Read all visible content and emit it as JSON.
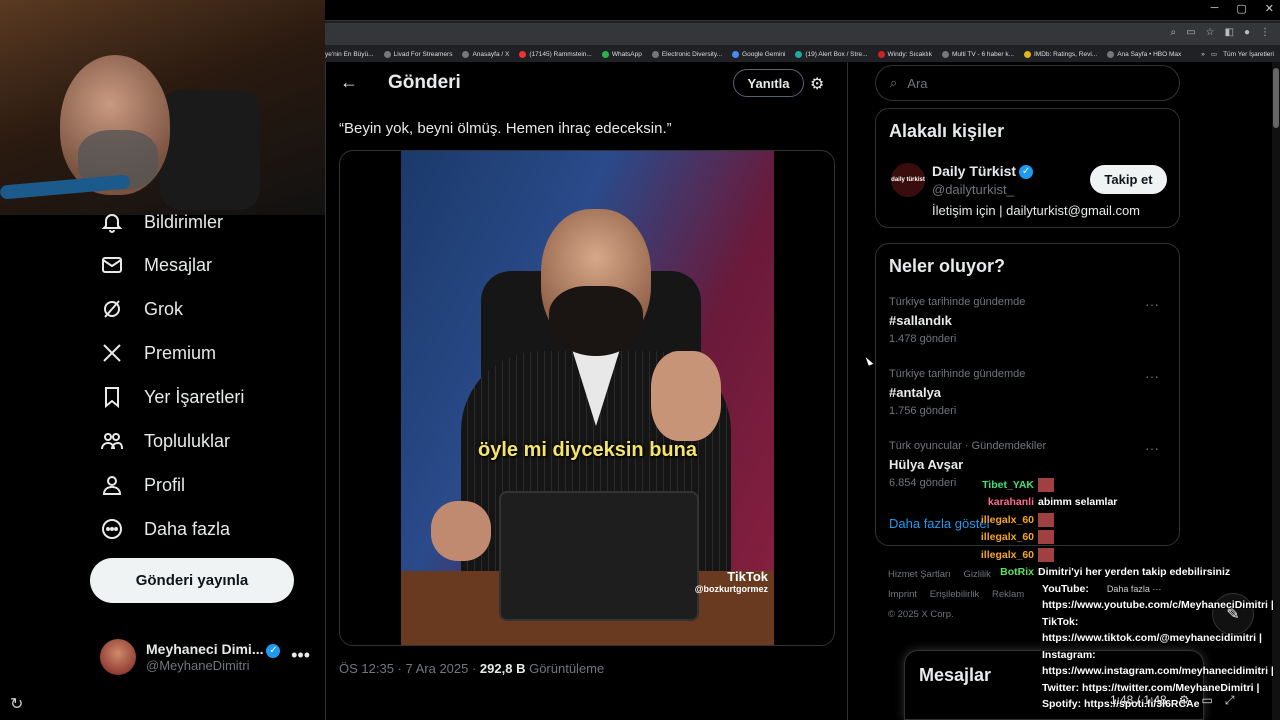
{
  "window": {
    "minimize": "─",
    "maximize": "▢",
    "close": "✕"
  },
  "bookmarks": [
    {
      "label": "ye'nin En Büyü..."
    },
    {
      "label": "Livad For Streamers"
    },
    {
      "label": "Anasayfa / X"
    },
    {
      "label": "(17145) Rammstein..."
    },
    {
      "label": "WhatsApp"
    },
    {
      "label": "Electronic Diversity..."
    },
    {
      "label": "Google Gemini"
    },
    {
      "label": "(19) Alert Box / Stre..."
    },
    {
      "label": "Windy: Sıcaklık"
    },
    {
      "label": "Multi TV - 6 haber k..."
    },
    {
      "label": "IMDb: Ratings, Revi..."
    },
    {
      "label": "Ana Sayfa • HBO Max"
    }
  ],
  "bookmarks_right": {
    "more": "»",
    "all": "Tüm Yer İşaretleri"
  },
  "nav": {
    "items": [
      {
        "label": "Bildirimler",
        "icon": "bell-icon"
      },
      {
        "label": "Mesajlar",
        "icon": "mail-icon"
      },
      {
        "label": "Grok",
        "icon": "grok-icon"
      },
      {
        "label": "Premium",
        "icon": "x-logo-icon"
      },
      {
        "label": "Yer İşaretleri",
        "icon": "bookmark-icon"
      },
      {
        "label": "Topluluklar",
        "icon": "people-icon"
      },
      {
        "label": "Profil",
        "icon": "person-icon"
      },
      {
        "label": "Daha fazla",
        "icon": "more-circle-icon"
      }
    ],
    "post_button": "Gönderi yayınla",
    "account": {
      "name": "Meyhaneci Dimi...",
      "handle": "@MeyhaneDimitri",
      "more": "•••"
    }
  },
  "main": {
    "back": "←",
    "title": "Gönderi",
    "reply_button": "Yanıtla",
    "quote": "“Beyin yok, beyni ölmüş. Hemen ihraç edeceksin.”",
    "video": {
      "caption": "öyle mi diyceksin buna",
      "brand": "TikTok",
      "user": "@bozkurtgormez"
    },
    "meta": {
      "time": "ÖS 12:35 · 7 Ara 2025 · ",
      "views": "292,8 B",
      "views_label": " Görüntüleme"
    }
  },
  "search": {
    "placeholder": "Ara"
  },
  "related": {
    "title": "Alakalı kişiler",
    "name": "Daily Türkist",
    "handle": "@dailyturkist_",
    "bio": "İletişim için | dailyturkist@gmail.com",
    "follow": "Takip et",
    "avatar_text": "daily türkist"
  },
  "trends": {
    "title": "Neler oluyor?",
    "items": [
      {
        "context": "Türkiye tarihinde gündemde",
        "name": "#sallandık",
        "count": "1.478 gönderi"
      },
      {
        "context": "Türkiye tarihinde gündemde",
        "name": "#antalya",
        "count": "1.756 gönderi"
      },
      {
        "context": "Türk oyuncular · Gündemdekiler",
        "name": "Hülya Avşar",
        "count": "6.854 gönderi"
      }
    ],
    "show_more": "Daha fazla göster"
  },
  "footer": {
    "links": [
      "Hizmet Şartları",
      "Gizlilik",
      "Imprint",
      "Erişilebilirlik",
      "Reklam"
    ],
    "copyright": "© 2025 X Corp."
  },
  "messages_drawer": {
    "title": "Mesajlar"
  },
  "chat": [
    {
      "user": "Tibet_YAK",
      "color": "#3ee07a",
      "text": ""
    },
    {
      "user": "karahanli",
      "color": "#ff6a8a",
      "text": "abimm selamlar"
    },
    {
      "user": "illegalx_60",
      "color": "#f5a623",
      "text": ""
    },
    {
      "user": "illegalx_60",
      "color": "#f5a623",
      "text": ""
    },
    {
      "user": "illegalx_60",
      "color": "#f5a623",
      "text": ""
    },
    {
      "user": "BotRix",
      "color": "#5fe05f",
      "text": "Dimitri'yi her yerden takip edebilirsiniz"
    },
    {
      "user": "",
      "color": "#fff",
      "text": "YouTube:"
    },
    {
      "user": "",
      "color": "#fff",
      "text": "https://www.youtube.com/c/MeyhaneciDimitri |"
    },
    {
      "user": "",
      "color": "#fff",
      "text": "TikTok:"
    },
    {
      "user": "",
      "color": "#fff",
      "text": "https://www.tiktok.com/@meyhanecidimitri |"
    },
    {
      "user": "",
      "color": "#fff",
      "text": "Instagram:"
    },
    {
      "user": "",
      "color": "#fff",
      "text": "https://www.instagram.com/meyhanecidimitri |"
    },
    {
      "user": "",
      "color": "#fff",
      "text": "Twitter: https://twitter.com/MeyhaneDimitri |"
    },
    {
      "user": "",
      "color": "#fff",
      "text": "Spotify: https://spoti.fi/3l6RCAe"
    }
  ],
  "chat_extra": {
    "more": "Daha fazla ···"
  },
  "video_time": "1:48 / 1:48"
}
